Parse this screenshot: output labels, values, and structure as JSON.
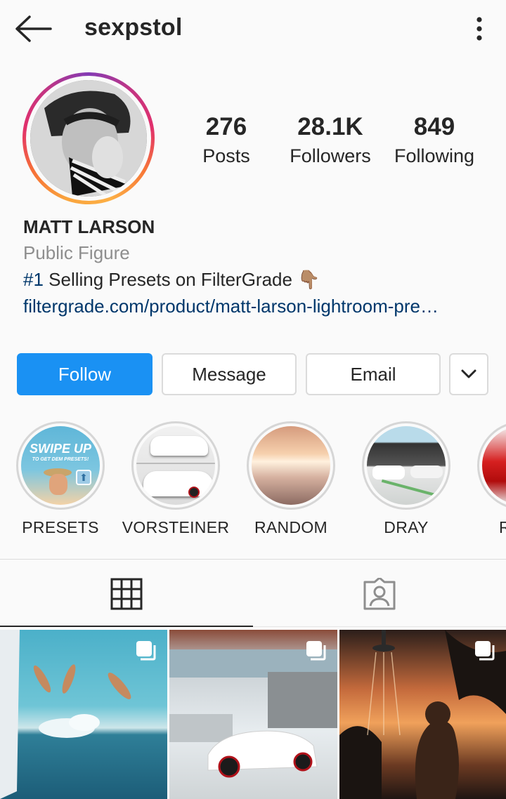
{
  "header": {
    "username": "sexpstol",
    "back_icon": "arrow-left-icon",
    "menu_icon": "more-vertical-icon"
  },
  "stats": {
    "posts": {
      "value": "276",
      "label": "Posts"
    },
    "followers": {
      "value": "28.1K",
      "label": "Followers"
    },
    "following": {
      "value": "849",
      "label": "Following"
    }
  },
  "bio": {
    "name": "MATT LARSON",
    "category": "Public Figure",
    "hashtag": "#1",
    "text": " Selling Presets on FilterGrade 👇🏽",
    "link": "filtergrade.com/product/matt-larson-lightroom-pre…"
  },
  "actions": {
    "follow": "Follow",
    "message": "Message",
    "email": "Email",
    "more_icon": "chevron-down-icon"
  },
  "highlights": [
    {
      "label": "PRESETS",
      "cover_text": "SWIPE UP",
      "cover_subtext": "TO GET DEM PRESETS!"
    },
    {
      "label": "VORSTEINER"
    },
    {
      "label": "RANDOM"
    },
    {
      "label": "DRAY"
    },
    {
      "label": "R"
    }
  ],
  "tabs": [
    {
      "name": "grid",
      "icon": "grid-icon",
      "active": true
    },
    {
      "name": "tagged",
      "icon": "tagged-person-icon",
      "active": false
    }
  ],
  "posts": [
    {
      "subject": "people jumping from boat into sea",
      "multiple": true
    },
    {
      "subject": "white car in front of building",
      "multiple": true
    },
    {
      "subject": "man under outdoor shower at sunset",
      "multiple": true
    }
  ],
  "colors": {
    "accent": "#1a91f3",
    "link": "#00376b",
    "muted": "#8e8e8e",
    "border": "#dbdbdb"
  }
}
